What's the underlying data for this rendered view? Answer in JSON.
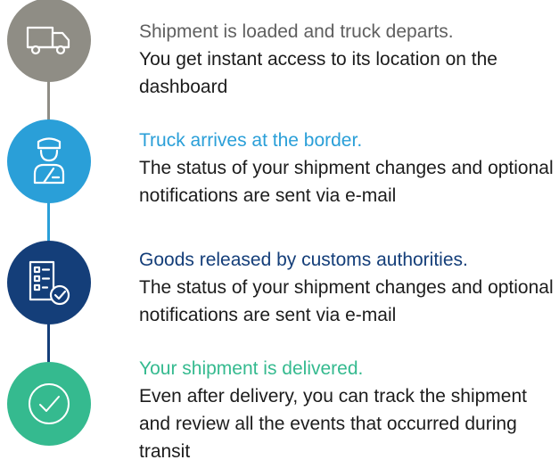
{
  "steps": [
    {
      "title": "Shipment is loaded and truck departs.",
      "description": "You get instant access to its location on the dashboard",
      "icon": "truck-icon",
      "icon_color": "#8f8d85",
      "title_color": "#5f5f5f"
    },
    {
      "title": "Truck arrives at the border.",
      "description": "The status of your shipment changes and optional notifications are sent via e-mail",
      "icon": "customs-officer-icon",
      "icon_color": "#2a9fd8",
      "title_color": "#2a9fd8"
    },
    {
      "title": "Goods released by customs authorities.",
      "description": "The status of your shipment changes and optional notifications are sent via e-mail",
      "icon": "document-check-icon",
      "icon_color": "#143e79",
      "title_color": "#143e79"
    },
    {
      "title": "Your shipment is delivered.",
      "description": "Even after delivery, you can track the shipment and review all the events that occurred during transit",
      "icon": "check-circle-icon",
      "icon_color": "#35ba8f",
      "title_color": "#35ba8f"
    }
  ],
  "connector_colors": [
    "#8f8d85",
    "#2a9fd8",
    "#143e79"
  ]
}
